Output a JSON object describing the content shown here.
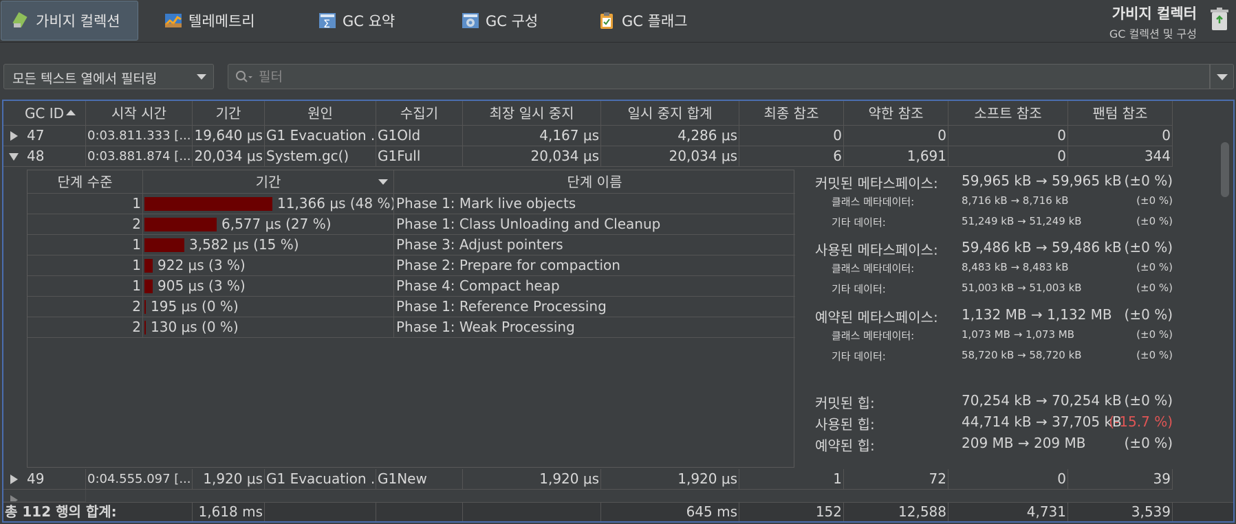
{
  "tabs": [
    {
      "label": "가비지 컬렉션",
      "icon": "garbage-collection-icon",
      "active": true
    },
    {
      "label": "텔레메트리",
      "icon": "telemetry-icon"
    },
    {
      "label": "GC 요약",
      "icon": "gc-summary-icon"
    },
    {
      "label": "GC 구성",
      "icon": "gc-config-icon"
    },
    {
      "label": "GC 플래그",
      "icon": "gc-flags-icon"
    }
  ],
  "header": {
    "title": "가비지 컬렉터",
    "subtitle": "GC 컬렉션 및 구성"
  },
  "filter": {
    "scope": "모든 텍스트 열에서 필터링",
    "placeholder": "필터",
    "value": ""
  },
  "columns": [
    "GC ID",
    "시작 시간",
    "기간",
    "원인",
    "수집기",
    "최장 일시 중지",
    "일시 중지 합계",
    "최종 참조",
    "약한 참조",
    "소프트 참조",
    "팬텀 참조"
  ],
  "rows": [
    {
      "id": "47",
      "start": "0:03.811.333 [...",
      "duration": "19,640 μs",
      "cause": "G1 Evacuation ...",
      "collector": "G1Old",
      "longest": "4,167 μs",
      "sum": "4,286 μs",
      "final": "0",
      "weak": "0",
      "soft": "0",
      "phantom": "0",
      "expanded": false
    },
    {
      "id": "48",
      "start": "0:03.881.874 [...",
      "duration": "20,034 μs",
      "cause": "System.gc()",
      "collector": "G1Full",
      "longest": "20,034 μs",
      "sum": "20,034 μs",
      "final": "6",
      "weak": "1,691",
      "soft": "0",
      "phantom": "344",
      "expanded": true
    },
    {
      "id": "49",
      "start": "0:04.555.097 [...",
      "duration": "1,920 μs",
      "cause": "G1 Evacuation ...",
      "collector": "G1New",
      "longest": "1,920 μs",
      "sum": "1,920 μs",
      "final": "1",
      "weak": "72",
      "soft": "0",
      "phantom": "39",
      "expanded": false
    }
  ],
  "phase_table": {
    "columns": [
      "단계 수준",
      "기간",
      "단계 이름"
    ],
    "rows": [
      {
        "level": "1",
        "duration": "11,366 μs (48 %)",
        "fraction": 0.48,
        "name": "Phase 1: Mark live objects"
      },
      {
        "level": "2",
        "duration": "6,577 μs (27 %)",
        "fraction": 0.27,
        "name": "Phase 1: Class Unloading and Cleanup"
      },
      {
        "level": "1",
        "duration": "3,582 μs (15 %)",
        "fraction": 0.15,
        "name": "Phase 3: Adjust pointers"
      },
      {
        "level": "1",
        "duration": "922 μs (3 %)",
        "fraction": 0.03,
        "name": "Phase 2: Prepare for compaction"
      },
      {
        "level": "1",
        "duration": "905 μs (3 %)",
        "fraction": 0.03,
        "name": "Phase 4: Compact heap"
      },
      {
        "level": "2",
        "duration": "195 μs (0 %)",
        "fraction": 0.0,
        "name": "Phase 1: Reference Processing"
      },
      {
        "level": "2",
        "duration": "130 μs (0 %)",
        "fraction": 0.0,
        "name": "Phase 1: Weak Processing"
      }
    ],
    "bar_color": "#6b0000"
  },
  "metaspace": [
    {
      "label": "커밋된 메타스페이스:",
      "value": "59,965 kB → 59,965 kB",
      "pct": "(±0 %)",
      "size": "big"
    },
    {
      "label": "클래스 메타데이터:",
      "value": "8,716 kB → 8,716 kB",
      "pct": "(±0 %)",
      "size": "small"
    },
    {
      "label": "기타 데이터:",
      "value": "51,249 kB → 51,249 kB",
      "pct": "(±0 %)",
      "size": "small"
    },
    {
      "label": "사용된 메타스페이스:",
      "value": "59,486 kB → 59,486 kB",
      "pct": "(±0 %)",
      "size": "big"
    },
    {
      "label": "클래스 메타데이터:",
      "value": "8,483 kB → 8,483 kB",
      "pct": "(±0 %)",
      "size": "small"
    },
    {
      "label": "기타 데이터:",
      "value": "51,003 kB → 51,003 kB",
      "pct": "(±0 %)",
      "size": "small"
    },
    {
      "label": "예약된 메타스페이스:",
      "value": "1,132 MB → 1,132 MB",
      "pct": "(±0 %)",
      "size": "big"
    },
    {
      "label": "클래스 메타데이터:",
      "value": "1,073 MB → 1,073 MB",
      "pct": "(±0 %)",
      "size": "small"
    },
    {
      "label": "기타 데이터:",
      "value": "58,720 kB → 58,720 kB",
      "pct": "(±0 %)",
      "size": "small"
    }
  ],
  "heap": [
    {
      "label": "커밋된 힙:",
      "value": "70,254 kB → 70,254 kB",
      "pct": "(±0 %)"
    },
    {
      "label": "사용된 힙:",
      "value": "44,714 kB → 37,705 kB",
      "pct": "(-15.7 %)",
      "negative": true
    },
    {
      "label": "예약된 힙:",
      "value": "209 MB → 209 MB",
      "pct": "(±0 %)"
    }
  ],
  "footer": {
    "label": "총 112 행의 합계:",
    "duration": "1,618 ms",
    "sum": "645 ms",
    "final": "152",
    "weak": "12,588",
    "soft": "4,731",
    "phantom": "3,539"
  },
  "colors": {
    "accent": "#4b6eaf",
    "negative": "#e05555",
    "background": "#3c3f41"
  }
}
